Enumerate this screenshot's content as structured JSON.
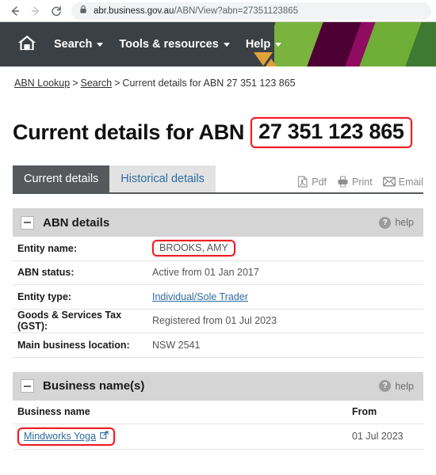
{
  "browser": {
    "back_icon": "back-arrow-icon",
    "forward_icon": "forward-arrow-icon",
    "reload_icon": "reload-icon",
    "lock_icon": "lock-icon",
    "url_domain": "abr.business.gov.au",
    "url_path": "/ABN/View?abn=27351123865"
  },
  "site_header": {
    "home_icon": "home-icon",
    "nav_items": [
      {
        "label": "Search",
        "caret": true
      },
      {
        "label": "Tools & resources",
        "caret": true
      },
      {
        "label": "Help",
        "caret": true
      }
    ],
    "logo_icon": "abr-triangles-logo-icon",
    "colors": {
      "dark": "#3b4044",
      "light_green": "#7ab33e",
      "dark_magenta": "#4d0033",
      "magenta": "#8f0c60",
      "green": "#6fae37",
      "forest_green": "#3f7a33",
      "logo_orange": "#e0a33a"
    }
  },
  "breadcrumb": {
    "items": [
      {
        "label": "ABN Lookup",
        "link": true
      },
      {
        "label": "Search",
        "link": true
      },
      {
        "label": "Current details for ABN 27 351 123 865",
        "link": false
      }
    ],
    "separator": ">"
  },
  "title": {
    "prefix": "Current details for ABN",
    "abn": "27 351 123 865",
    "highlight_color": "#ee1c25"
  },
  "tabs": [
    {
      "label": "Current details",
      "active": true
    },
    {
      "label": "Historical details",
      "active": false
    }
  ],
  "doc_actions": [
    {
      "label": "Pdf",
      "icon": "pdf-icon"
    },
    {
      "label": "Print",
      "icon": "printer-icon"
    },
    {
      "label": "Email",
      "icon": "envelope-icon"
    }
  ],
  "panels": {
    "abn_details": {
      "title": "ABN details",
      "help_label": "help",
      "help_badge": "?",
      "collapse_icon": "collapse-minus-icon",
      "rows": [
        {
          "label": "Entity name:",
          "value": "BROOKS, AMY",
          "link": false,
          "highlighted": true
        },
        {
          "label": "ABN status:",
          "value": "Active from 01 Jan 2017",
          "link": false,
          "highlighted": false
        },
        {
          "label": "Entity type:",
          "value": "Individual/Sole Trader",
          "link": true,
          "highlighted": false
        },
        {
          "label": "Goods & Services Tax (GST):",
          "value": "Registered from 01 Jul 2023",
          "link": false,
          "highlighted": false
        },
        {
          "label": "Main business location:",
          "value": "NSW 2541",
          "link": false,
          "highlighted": false
        }
      ]
    },
    "business_names": {
      "title": "Business name(s)",
      "help_label": "help",
      "help_badge": "?",
      "collapse_icon": "collapse-minus-icon",
      "columns": {
        "name": "Business name",
        "from": "From"
      },
      "rows": [
        {
          "name": "Mindworks Yoga",
          "from": "01 Jul 2023",
          "highlighted": true,
          "external_icon": "external-link-icon"
        }
      ]
    }
  }
}
